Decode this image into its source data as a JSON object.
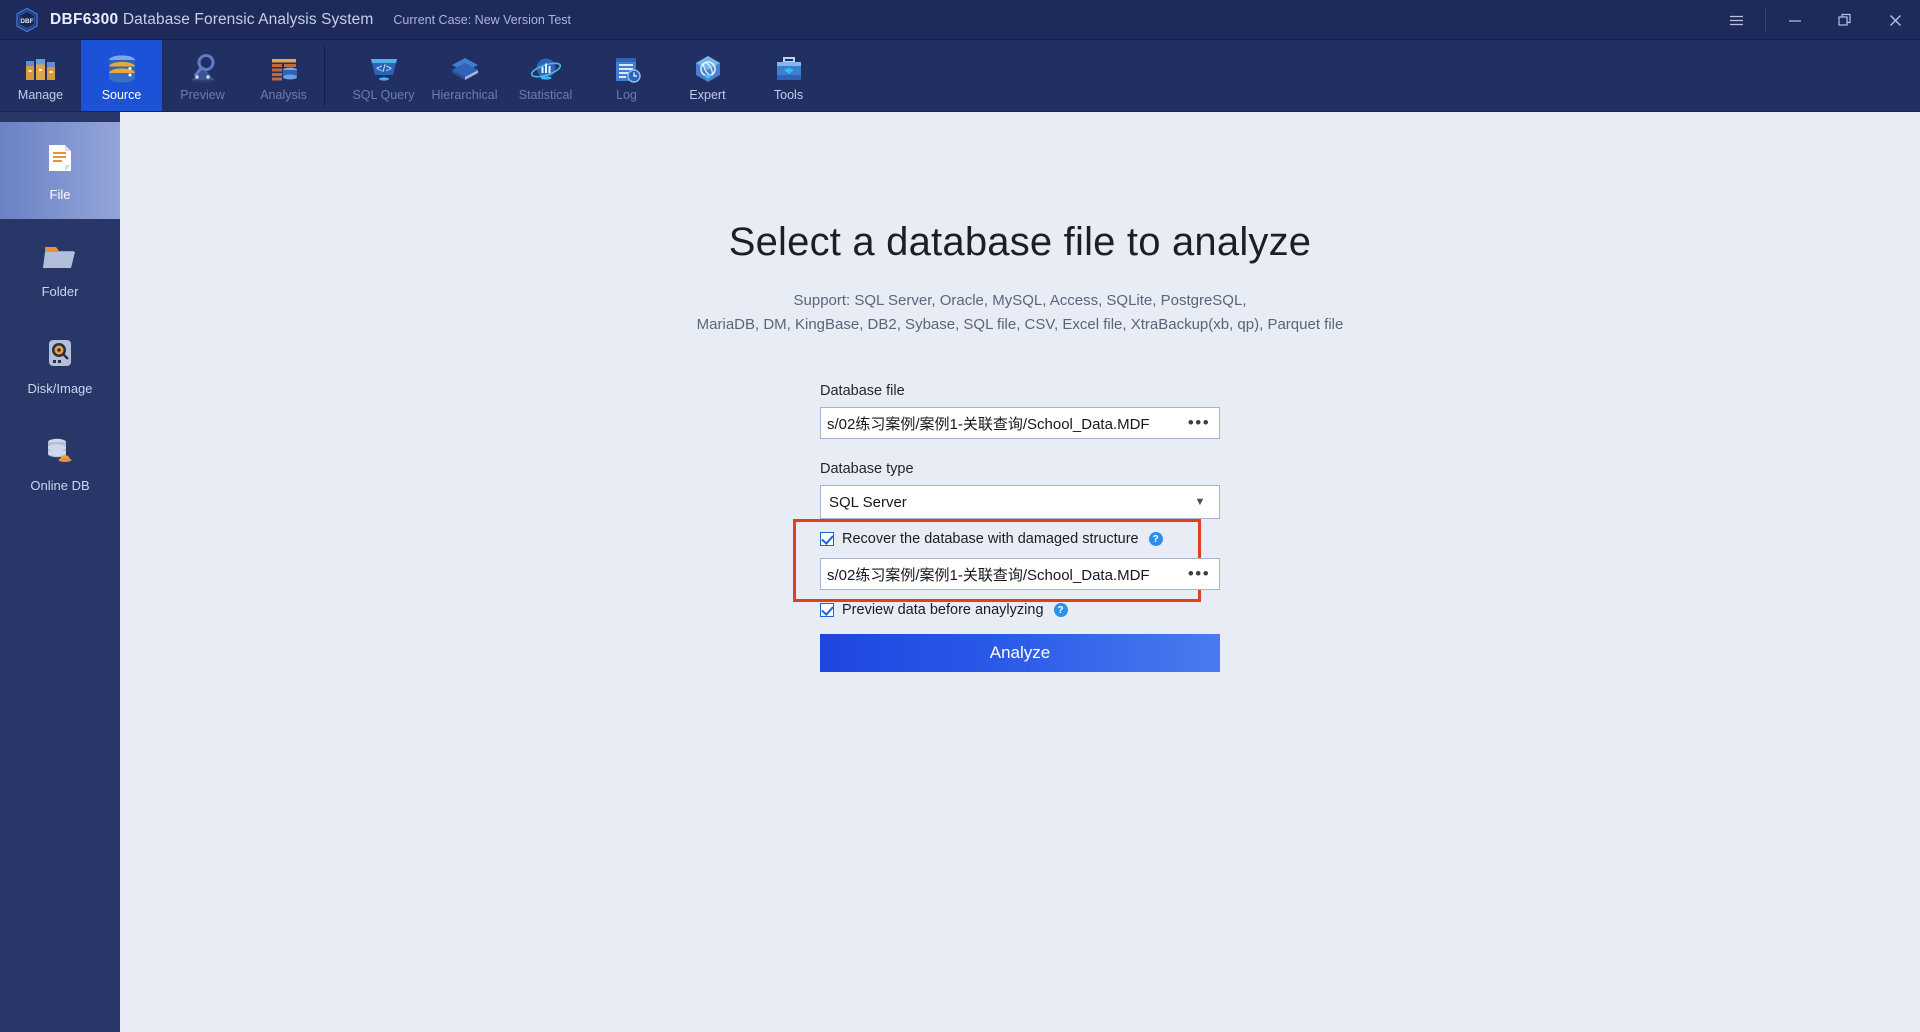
{
  "titlebar": {
    "logo_text": "DBF",
    "app_name_bold": "DBF6300",
    "app_name_rest": " Database Forensic Analysis System",
    "case_label": "Current Case: New Version Test",
    "menu_icon": "hamburger-icon",
    "minimize_icon": "minimize-icon",
    "restore_icon": "restore-icon",
    "close_icon": "close-icon"
  },
  "ribbon": {
    "items": [
      {
        "label": "Manage",
        "icon": "archive-boxes-icon",
        "state": "normal"
      },
      {
        "label": "Source",
        "icon": "database-icon",
        "state": "active"
      },
      {
        "label": "Preview",
        "icon": "magnifier-icon",
        "state": "dim"
      },
      {
        "label": "Analysis",
        "icon": "table-analysis-icon",
        "state": "dim"
      },
      {
        "label": "SQL Query",
        "icon": "code-brackets-icon",
        "state": "dim"
      },
      {
        "label": "Hierarchical",
        "icon": "layers-icon",
        "state": "dim"
      },
      {
        "label": "Statistical",
        "icon": "globe-chart-icon",
        "state": "dim"
      },
      {
        "label": "Log",
        "icon": "log-clock-icon",
        "state": "dim"
      },
      {
        "label": "Expert",
        "icon": "expert-atom-icon",
        "state": "normal"
      },
      {
        "label": "Tools",
        "icon": "toolbox-icon",
        "state": "normal"
      }
    ]
  },
  "sidebar": {
    "items": [
      {
        "label": "File",
        "icon": "file-document-icon",
        "state": "active"
      },
      {
        "label": "Folder",
        "icon": "folder-icon",
        "state": "normal"
      },
      {
        "label": "Disk/Image",
        "icon": "disk-image-icon",
        "state": "normal"
      },
      {
        "label": "Online DB",
        "icon": "online-db-icon",
        "state": "normal"
      }
    ]
  },
  "main": {
    "headline": "Select a database file to analyze",
    "support_line1": "Support: SQL Server, Oracle, MySQL, Access, SQLite, PostgreSQL,",
    "support_line2": "MariaDB, DM, KingBase, DB2, Sybase, SQL file, CSV, Excel file, XtraBackup(xb, qp), Parquet file",
    "db_file_label": "Database file",
    "db_file_value": "s/02练习案例/案例1-关联查询/School_Data.MDF",
    "db_file_browse": "•••",
    "db_type_label": "Database type",
    "db_type_value": "SQL Server",
    "db_type_caret": "▼",
    "recover_checkbox_label": "Recover the database with damaged structure",
    "recover_help": "?",
    "recover_file_value": "s/02练习案例/案例1-关联查询/School_Data.MDF",
    "recover_file_browse": "•••",
    "preview_checkbox_label": "Preview data before anaylyzing",
    "preview_help": "?",
    "analyze_button": "Analyze"
  },
  "colors": {
    "titlebar_bg": "#1e2a5a",
    "ribbon_bg": "#222f62",
    "ribbon_active": "#1b52d8",
    "sidebar_bg": "#283668",
    "content_bg": "#e8ecf5",
    "highlight_border": "#e0401b",
    "accent_blue": "#1766d6",
    "help_badge": "#2f8fe6"
  }
}
